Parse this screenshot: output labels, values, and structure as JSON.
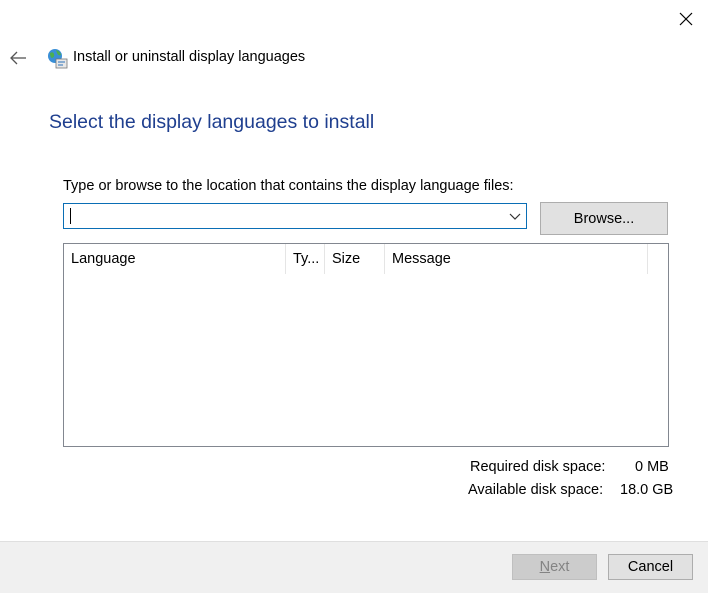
{
  "window": {
    "title": "Install or uninstall display languages",
    "close_icon": "close-icon",
    "back_icon": "back-arrow-icon",
    "app_icon": "globe-language-icon"
  },
  "main": {
    "heading": "Select the display languages to install",
    "path_label": "Type or browse to the location that contains the display language files:",
    "path_value": "",
    "browse_label": "Browse..."
  },
  "table": {
    "columns": [
      "Language",
      "Ty...",
      "Size",
      "Message"
    ],
    "rows": []
  },
  "disk": {
    "required_label": "Required disk space:",
    "required_value": "0 MB",
    "available_label": "Available disk space:",
    "available_value": "18.0 GB"
  },
  "footer": {
    "next_label": "Next",
    "cancel_label": "Cancel"
  },
  "colors": {
    "heading": "#1f3f8f",
    "focus_border": "#0a6eb5",
    "footer_bg": "#f0f0f0"
  }
}
